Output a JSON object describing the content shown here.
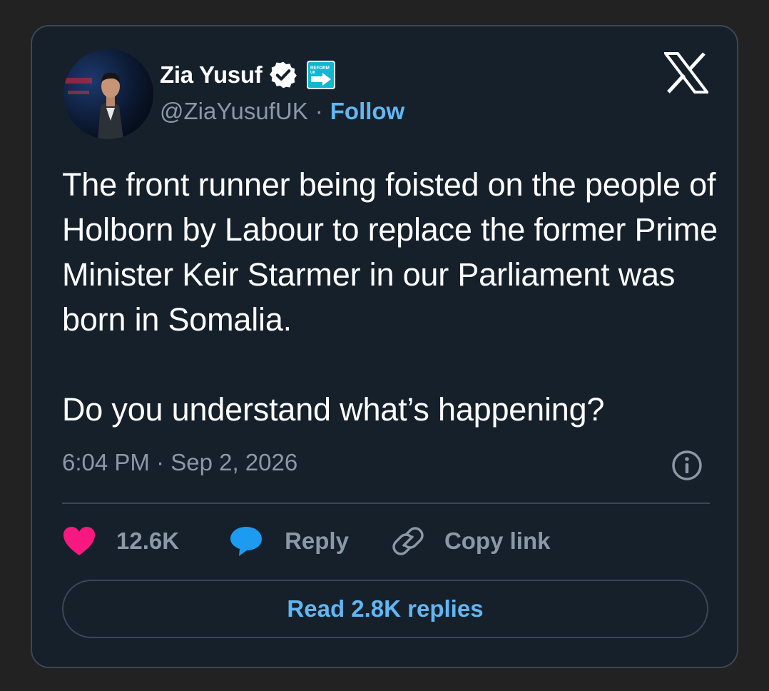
{
  "author": {
    "name": "Zia Yusuf",
    "handle": "@ZiaYusufUK",
    "follow_label": "Follow",
    "verified_icon": "verified-badge-icon",
    "affiliation_badge_text": "REFORM UK"
  },
  "tweet": {
    "text_paragraphs": [
      "The front runner being foisted on the people of Holborn by Labour to replace the former Prime Minister Keir Starmer in our Parliament was born in Somalia.",
      "Do you understand what’s happening?"
    ],
    "timestamp": "6:04 PM · Sep 2, 2026"
  },
  "actions": {
    "likes": "12.6K",
    "reply_label": "Reply",
    "copy_link_label": "Copy link"
  },
  "read_replies_label": "Read 2.8K replies",
  "colors": {
    "background": "#222222",
    "card": "#16202b",
    "border": "#3b4754",
    "text_primary": "#ffffff",
    "text_secondary": "#8b98a5",
    "accent_blue": "#62b7f3",
    "like_pink": "#f91880",
    "reply_blue": "#1d9bf0",
    "affiliation_badge": "#12b6cf"
  }
}
